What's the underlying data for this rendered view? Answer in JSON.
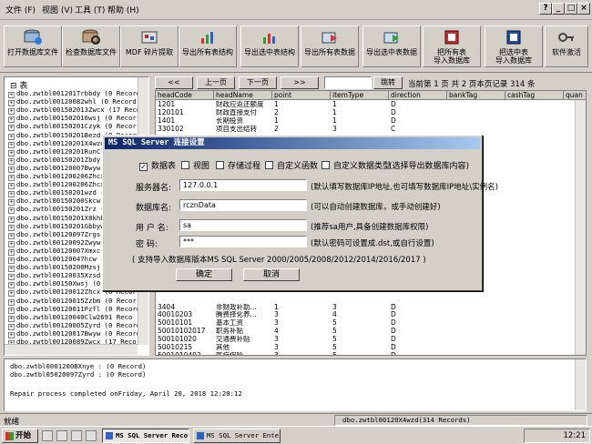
{
  "menu": {
    "file": "文件 (F)",
    "view": "视图 (V)",
    "tools": "工具 (T)",
    "help": "帮助 (H)"
  },
  "window_controls": {
    "help": "?",
    "minimize": "_",
    "restore": "□",
    "close": "×"
  },
  "toolbar": [
    {
      "label": "打开数据库文件"
    },
    {
      "label": "检查数据库文件"
    },
    {
      "label": "MDF 碎片提取"
    },
    {
      "label": "导出所有表结构"
    },
    {
      "label": "导出选中表结构"
    },
    {
      "label": "导出所有表数据"
    },
    {
      "label": "导出选中表数据"
    },
    {
      "label": "把所有表",
      "label2": "导入数据库"
    },
    {
      "label": "把选中表",
      "label2": "导入数据库"
    },
    {
      "label": "软件激活"
    }
  ],
  "tree": {
    "root": "表",
    "items": [
      "dbo.zwtbl001201Trbbdy (0 Record",
      "dbo.zwtbl00120082whl (0 Record",
      "dbo.zwtbl001502013Zwcx (17 Recor",
      "dbo.zwtbl001502016wsj (0 Recor",
      "dbo.zwtbl00150201Czyk (0 Recor",
      "dbo.zwtbl00150201Bezd (0 Recor",
      "dbo.zwtbl00120201X4wzd (314 Rec",
      "dbo.zwtbl00120201RunCl (Recor",
      "dbo.zwtbl00150201Zbdy (0 Recor",
      "dbo.zwtbl00120007Bwyw (0 Recor",
      "dbo.zwtbl001200206Zhcx (0 Recor",
      "dbo.zwtbl001200206Zhcx (0 Recor",
      "dbo.zwtbl00150201wzd (20 Recor",
      "dbo.zwtbl00150200Skcw (0 Recor",
      "dbo.zwtbl00150201Zrz (16 Recor",
      "dbo.zwtbl00150201X8khb (0 Recor",
      "dbo.zwtbl00150201Gbbyw (0 Recor",
      "dbo.zwtbl00120097Zrgs (0 Recor",
      "dbo.zwtbl00120092Zwyw (0 Recor",
      "dbo.zwtbl00120007Xmxc (0 Recor",
      "dbo.zwtbl00120047hcw (0 Recor",
      "dbo.zwtbl00150200Mzsj (0 Recor",
      "dbo.zwtbl00120035Xzsd (0 Recor",
      "dbo.zwtbl00150Xwsj (0 Record",
      "dbo.zwtbl00120012Zhcx (0 Recor",
      "dbo.zwtbl00120015Zzbm (0 Recor",
      "dbo.zwtbl00120011Pzfl (0 Record",
      "dbo.zwtbl00120040Clw2691 Reco",
      "dbo.zwtbl00120005Zyrd (0 Record",
      "dbo.zwtbl00120017Bwyw (0 Record",
      "dbo.zwtbl00120089Zwcx (17 Recor"
    ]
  },
  "nav": {
    "first": "<<",
    "prev": "上一页",
    "next": "下一页",
    "last": ">>",
    "jump_value": "",
    "jump": "跳转",
    "info": "当前第  1  页 共  2  页本页记录  314  条"
  },
  "grid": {
    "columns": [
      "headCode",
      "headName",
      "point",
      "itemType",
      "direction",
      "bankTag",
      "cashTag",
      "quan"
    ],
    "rows": [
      [
        "1201",
        "财政应返还额度",
        "1",
        "1",
        "D",
        "",
        "",
        ""
      ],
      [
        "120101",
        "财政直接支付",
        "2",
        "1",
        "D",
        "",
        "",
        ""
      ],
      [
        "1401",
        "长期投资",
        "1",
        "1",
        "D",
        "",
        "",
        ""
      ],
      [
        "330102",
        "项目支出结转",
        "2",
        "3",
        "C",
        "",
        "",
        ""
      ],
      [
        "",
        "",
        "",
        "",
        "",
        "",
        "",
        ""
      ],
      [
        "",
        "",
        "",
        "",
        "",
        "",
        "",
        ""
      ],
      [
        "",
        "",
        "",
        "",
        "",
        "",
        "",
        ""
      ],
      [
        "",
        "",
        "",
        "",
        "",
        "",
        "",
        ""
      ],
      [
        "",
        "",
        "",
        "",
        "",
        "",
        "",
        ""
      ],
      [
        "",
        "",
        "",
        "",
        "",
        "",
        "",
        ""
      ],
      [
        "",
        "",
        "",
        "",
        "",
        "",
        "",
        ""
      ],
      [
        "",
        "",
        "",
        "",
        "",
        "",
        "",
        ""
      ],
      [
        "",
        "",
        "",
        "",
        "",
        "",
        "",
        ""
      ],
      [
        "",
        "",
        "",
        "",
        "",
        "",
        "",
        ""
      ],
      [
        "",
        "",
        "",
        "",
        "",
        "",
        "",
        ""
      ],
      [
        "",
        "",
        "",
        "",
        "",
        "",
        "",
        ""
      ],
      [
        "",
        "",
        "",
        "",
        "",
        "",
        "",
        ""
      ],
      [
        "",
        "",
        "",
        "",
        "",
        "",
        "",
        ""
      ],
      [
        "",
        "",
        "",
        "",
        "",
        "",
        "",
        ""
      ],
      [
        "",
        "",
        "",
        "",
        "",
        "",
        "",
        ""
      ],
      [
        "",
        "",
        "",
        "",
        "",
        "",
        "",
        ""
      ],
      [
        "",
        "",
        "",
        "",
        "",
        "",
        "",
        ""
      ],
      [
        "",
        "",
        "",
        "",
        "",
        "",
        "",
        ""
      ],
      [
        "",
        "",
        "",
        "",
        "",
        "",
        "",
        ""
      ],
      [
        "",
        "",
        "",
        "",
        "",
        "",
        "",
        ""
      ],
      [
        "3404",
        "非财政补助...",
        "1",
        "3",
        "D",
        "",
        "",
        ""
      ],
      [
        "40010203",
        "腾费择化养...",
        "3",
        "4",
        "D",
        "",
        "",
        ""
      ],
      [
        "50010101",
        "基本工资",
        "3",
        "5",
        "D",
        "",
        "",
        ""
      ],
      [
        "50010102017",
        "职务补贴",
        "4",
        "5",
        "D",
        "",
        "",
        ""
      ],
      [
        "500101020",
        "交通费补贴",
        "3",
        "5",
        "D",
        "",
        "",
        ""
      ],
      [
        "50010215",
        "其他",
        "3",
        "5",
        "D",
        "",
        "",
        ""
      ],
      [
        "5001010402",
        "医疗保险",
        "3",
        "5",
        "D",
        "",
        "",
        ""
      ]
    ]
  },
  "log": [
    "dbo.zwtbl0001200BXnye : (0 Record)",
    "dbo.zwtbl05020097Zyrd : (0 Record)",
    "",
    "Repair process completed onFriday, April 20, 2018 12:20:12"
  ],
  "status": {
    "left": "就绪",
    "right": "dbo.zwtbl00120X4wzd(314 Records)"
  },
  "taskbar": {
    "start": "开始",
    "tasks": [
      "MS SQL Server Recovery",
      "MS SQL Server Enterpri..."
    ],
    "time": "12:21"
  },
  "dialog": {
    "title": "MS SQL Server 连接设置",
    "checks": [
      {
        "label": "数据表",
        "checked": true
      },
      {
        "label": "视图",
        "checked": false
      },
      {
        "label": "存储过程",
        "checked": false
      },
      {
        "label": "自定义函数",
        "checked": false
      },
      {
        "label": "自定义数据类型",
        "checked": false
      }
    ],
    "checks_hint": "(选择导出数据库内容)",
    "fields": [
      {
        "label": "服务器名:",
        "value": "127.0.0.1",
        "hint": "(默认填写数据库IP地址,也可填写数据库IP地址\\实例名)"
      },
      {
        "label": "数据库名:",
        "value": "rcznData",
        "hint": "(可以自动创建数据库，或手动创建好)"
      },
      {
        "label": "用 户 名:",
        "value": "sa",
        "hint": "(推荐sa用户,具备创建数据库权限)"
      },
      {
        "label": "密    码:",
        "value": "***",
        "hint": "(默认密码可设置成.dst,或自行设置)"
      }
    ],
    "note": "( 支持导入数据库版本MS SQL Server 2000/2005/2008/2012/2014/2016/2017 )",
    "ok": "确定",
    "cancel": "取消"
  }
}
